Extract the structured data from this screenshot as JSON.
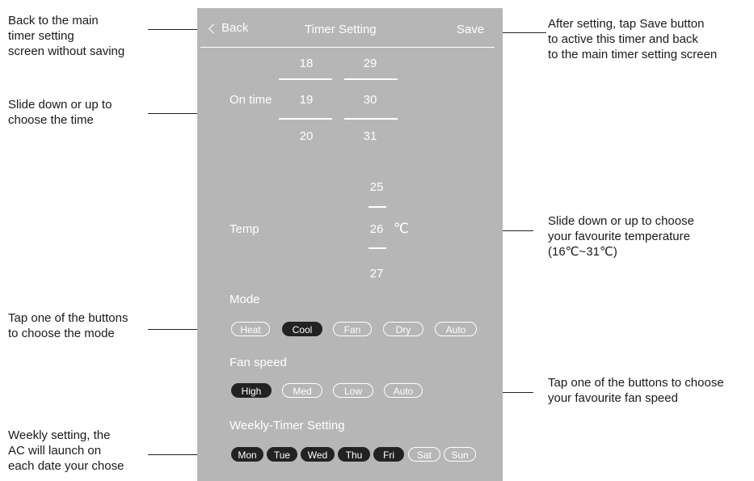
{
  "header": {
    "back": "Back",
    "title": "Timer Setting",
    "save": "Save"
  },
  "on_time": {
    "label": "On time",
    "hours": [
      "18",
      "19",
      "20"
    ],
    "minutes": [
      "29",
      "30",
      "31"
    ]
  },
  "temp": {
    "label": "Temp",
    "values": [
      "25",
      "26",
      "27"
    ],
    "unit": "℃"
  },
  "mode": {
    "label": "Mode",
    "options": [
      "Heat",
      "Cool",
      "Fan",
      "Dry",
      "Auto"
    ],
    "selected": "Cool"
  },
  "fan_speed": {
    "label": "Fan speed",
    "options": [
      "High",
      "Med",
      "Low",
      "Auto"
    ],
    "selected": "High"
  },
  "weekly": {
    "label": "Weekly-Timer Setting",
    "days": [
      "Mon",
      "Tue",
      "Wed",
      "Thu",
      "Fri",
      "Sat",
      "Sun"
    ],
    "selected": [
      "Mon",
      "Tue",
      "Wed",
      "Thu",
      "Fri"
    ]
  },
  "annotations": {
    "back": [
      "Back to the main",
      "timer setting",
      "screen without saving"
    ],
    "save": [
      "After setting, tap Save button",
      "to active this timer and back",
      "to the main timer setting screen"
    ],
    "time": [
      "Slide down or up to",
      "choose the time"
    ],
    "temp": [
      "Slide down or up to choose",
      "your favourite temperature",
      "(16℃~31℃)"
    ],
    "mode": [
      "Tap one of the buttons",
      "to choose the mode"
    ],
    "fan": [
      "Tap one of the buttons to choose",
      "your favourite fan speed"
    ],
    "weekly": [
      "Weekly setting, the",
      "AC will launch on",
      "each date your chose"
    ]
  }
}
